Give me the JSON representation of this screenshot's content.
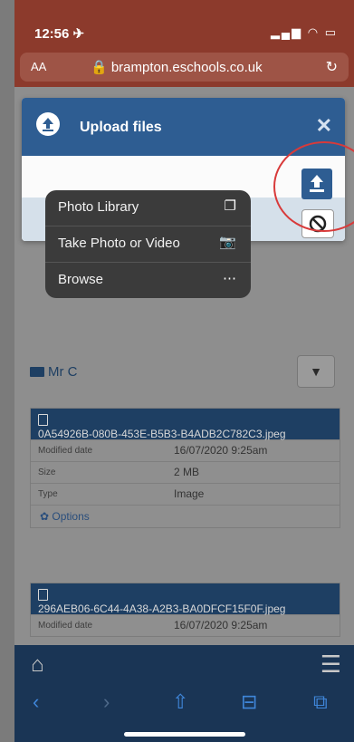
{
  "status": {
    "time": "12:56 ✈"
  },
  "browser": {
    "text_size": "AA",
    "url": "🔒 brampton.eschools.co.uk",
    "reload_glyph": "↻"
  },
  "modal": {
    "title": "Upload files",
    "close_glyph": "✕"
  },
  "popup_menu": {
    "items": [
      {
        "label": "Photo Library",
        "icon": "photo-library-icon",
        "glyph": "❐"
      },
      {
        "label": "Take Photo or Video",
        "icon": "camera-icon",
        "glyph": "📷"
      },
      {
        "label": "Browse",
        "icon": "more-icon",
        "glyph": "⋯"
      }
    ]
  },
  "folder": {
    "label": "Mr C",
    "toggle_glyph": "▼"
  },
  "files": [
    {
      "name": "0A54926B-080B-453E-B5B3-B4ADB2C782C3.jpeg",
      "rows": [
        {
          "k": "Modified date",
          "v": "16/07/2020 9:25am"
        },
        {
          "k": "Size",
          "v": "2 MB"
        },
        {
          "k": "Type",
          "v": "Image"
        }
      ],
      "options_label": "✿ Options"
    },
    {
      "name": "296AEB06-6C44-4A38-A2B3-BA0DFCF15F0F.jpeg",
      "rows": [
        {
          "k": "Modified date",
          "v": "16/07/2020 9:25am"
        }
      ]
    }
  ],
  "nav": {
    "home_glyph": "⌂",
    "menu_glyph": "☰"
  },
  "toolbar": {
    "back": "‹",
    "forward": "›",
    "share": "⇧",
    "bookmarks": "⊟",
    "tabs": "⧉"
  },
  "colors": {
    "accent": "#2e5d92",
    "highlight_circle": "#d83a3a",
    "browser_bar": "#8c3a2c"
  }
}
